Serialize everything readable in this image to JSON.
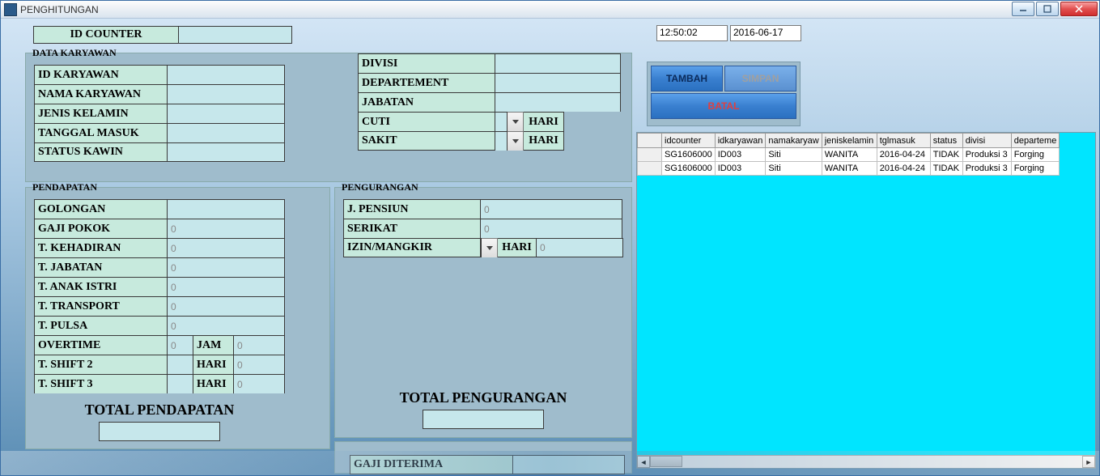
{
  "window": {
    "title": "PENGHITUNGAN"
  },
  "header": {
    "id_counter_label": "ID COUNTER",
    "time": "12:50:02",
    "date": "2016-06-17"
  },
  "buttons": {
    "tambah": "TAMBAH",
    "simpan": "SIMPAN",
    "batal": "BATAL"
  },
  "data_karyawan": {
    "title": "DATA KARYAWAN",
    "id_label": "ID KARYAWAN",
    "nama_label": "NAMA KARYAWAN",
    "jk_label": "JENIS KELAMIN",
    "tgl_label": "TANGGAL MASUK",
    "status_label": "STATUS KAWIN",
    "divisi_label": "DIVISI",
    "dept_label": "DEPARTEMENT",
    "jabatan_label": "JABATAN",
    "cuti_label": "CUTI",
    "sakit_label": "SAKIT",
    "hari": "HARI"
  },
  "pendapatan": {
    "title": "PENDAPATAN",
    "golongan": "GOLONGAN",
    "gaji_pokok": "GAJI POKOK",
    "t_kehadiran": "T. KEHADIRAN",
    "t_jabatan": "T. JABATAN",
    "t_anak": "T. ANAK ISTRI",
    "t_transport": "T. TRANSPORT",
    "t_pulsa": "T. PULSA",
    "overtime": "OVERTIME",
    "shift2": "T. SHIFT 2",
    "shift3": "T. SHIFT 3",
    "jam": "JAM",
    "hari": "HARI",
    "zero": "0",
    "total_label": "TOTAL PENDAPATAN"
  },
  "pengurangan": {
    "title": "PENGURANGAN",
    "jpensiun": "J. PENSIUN",
    "serikat": "SERIKAT",
    "izin": "IZIN/MANGKIR",
    "hari": "HARI",
    "zero": "0",
    "total_label": "TOTAL PENGURANGAN"
  },
  "gaji": {
    "label": "GAJI DITERIMA"
  },
  "grid": {
    "headers": [
      "",
      "idcounter",
      "idkaryawan",
      "namakaryaw",
      "jeniskelamin",
      "tglmasuk",
      "status",
      "divisi",
      "departeme"
    ],
    "rows": [
      [
        "",
        "SG1606000",
        "ID003",
        "Siti",
        "WANITA",
        "2016-04-24",
        "TIDAK",
        "Produksi 3",
        "Forging"
      ],
      [
        "",
        "SG1606000",
        "ID003",
        "Siti",
        "WANITA",
        "2016-04-24",
        "TIDAK",
        "Produksi 3",
        "Forging"
      ]
    ]
  }
}
